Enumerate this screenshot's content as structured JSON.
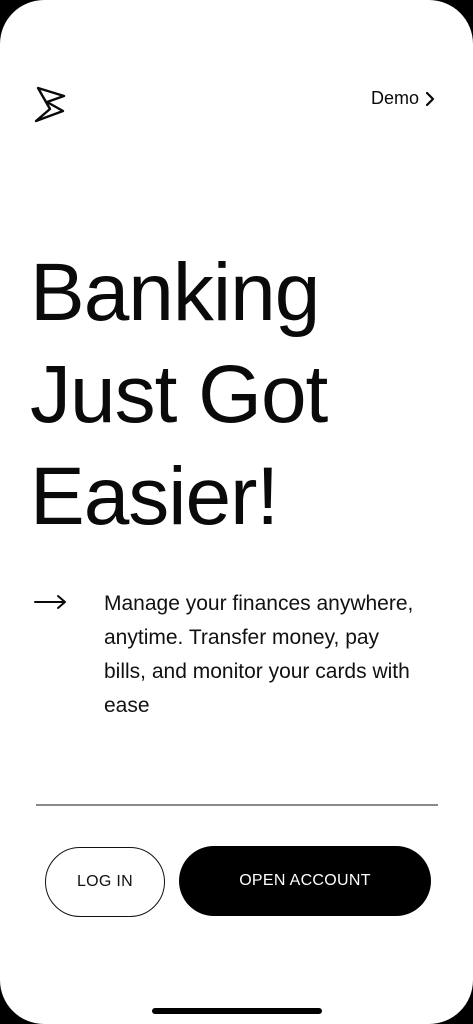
{
  "header": {
    "logo_icon": "bolt-s-logo-icon",
    "demo_label": "Demo",
    "demo_icon": "chevron-right-icon"
  },
  "hero": {
    "headline_lines": [
      "Banking",
      "Just Got",
      "Easier!"
    ],
    "arrow_icon": "arrow-right-icon",
    "description": "Manage your finances anywhere, anytime. Transfer money, pay bills, and monitor your cards with ease"
  },
  "actions": {
    "login_label": "LOG IN",
    "open_account_label": "OPEN ACCOUNT"
  },
  "colors": {
    "background": "#ffffff",
    "text": "#0a0a0a",
    "primary_button": "#000000",
    "divider": "#8a8a8a"
  }
}
